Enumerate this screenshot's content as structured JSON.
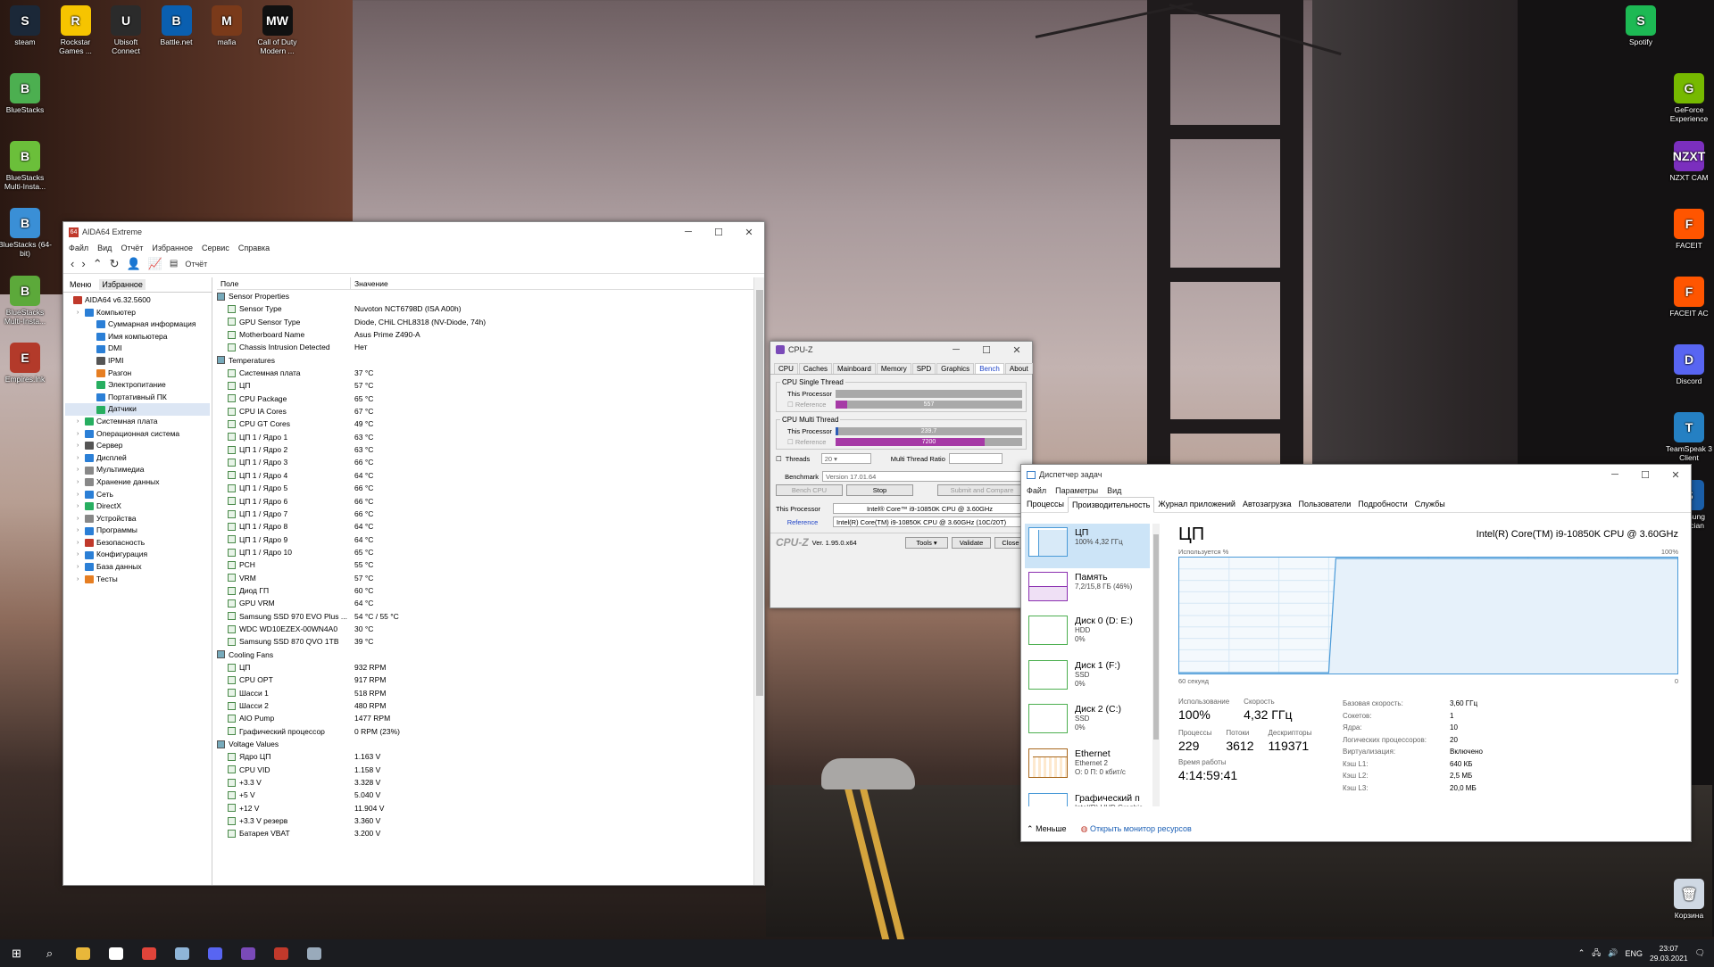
{
  "desktop": {
    "icons_left": [
      {
        "label": "steam",
        "color": "#1b2838",
        "glyph": "S"
      },
      {
        "label": "Rockstar Games ...",
        "color": "#f6c400",
        "glyph": "R"
      },
      {
        "label": "Ubisoft Connect",
        "color": "#2b2b2b",
        "glyph": "U"
      },
      {
        "label": "Battle.net",
        "color": "#0a5fb0",
        "glyph": "B"
      },
      {
        "label": "mafia",
        "color": "#7a3a1a",
        "glyph": "M"
      },
      {
        "label": "Call of Duty Modern ...",
        "color": "#111111",
        "glyph": "MW"
      }
    ],
    "icons_col": [
      {
        "label": "BlueStacks",
        "color": "#4caf50",
        "glyph": "B"
      },
      {
        "label": "BlueStacks Multi-Insta...",
        "color": "#6bbf3a",
        "glyph": "B"
      },
      {
        "label": "BlueStacks (64-bit)",
        "color": "#3a8fd6",
        "glyph": "B"
      },
      {
        "label": "BlueStacks Multi-Insta...",
        "color": "#5ca93a",
        "glyph": "B"
      },
      {
        "label": "Empires.lnk",
        "color": "#b33a2a",
        "glyph": "E"
      }
    ],
    "icons_right": [
      {
        "label": "Spotify",
        "color": "#1db954",
        "glyph": "S"
      },
      {
        "label": "GeForce Experience",
        "color": "#76b900",
        "glyph": "G"
      },
      {
        "label": "NZXT CAM",
        "color": "#7b2fbe",
        "glyph": "NZXT"
      },
      {
        "label": "FACEIT",
        "color": "#ff5500",
        "glyph": "F"
      },
      {
        "label": "FACEIT AC",
        "color": "#ff5500",
        "glyph": "F"
      },
      {
        "label": "Discord",
        "color": "#5865f2",
        "glyph": "D"
      },
      {
        "label": "TeamSpeak 3 Client",
        "color": "#2580c3",
        "glyph": "T"
      },
      {
        "label": "Samsung Magician",
        "color": "#1a5ea8",
        "glyph": "S"
      },
      {
        "label": "Корзина",
        "color": "#cfd8e3",
        "glyph": "🗑"
      }
    ]
  },
  "aida": {
    "title": "AIDA64 Extreme",
    "menu": [
      "Файл",
      "Вид",
      "Отчёт",
      "Избранное",
      "Сервис",
      "Справка"
    ],
    "report_label": "Отчёт",
    "tabs": [
      "Меню",
      "Избранное"
    ],
    "tree": [
      {
        "label": "AIDA64 v6.32.5600",
        "indent": 0,
        "color": "#c0392b"
      },
      {
        "label": "Компьютер",
        "indent": 1,
        "color": "#2b7fd6"
      },
      {
        "label": "Суммарная информация",
        "indent": 2,
        "color": "#2b7fd6"
      },
      {
        "label": "Имя компьютера",
        "indent": 2,
        "color": "#2b7fd6"
      },
      {
        "label": "DMI",
        "indent": 2,
        "color": "#2b7fd6"
      },
      {
        "label": "IPMI",
        "indent": 2,
        "color": "#555"
      },
      {
        "label": "Разгон",
        "indent": 2,
        "color": "#e67e22"
      },
      {
        "label": "Электропитание",
        "indent": 2,
        "color": "#27ae60"
      },
      {
        "label": "Портативный ПК",
        "indent": 2,
        "color": "#2b7fd6"
      },
      {
        "label": "Датчики",
        "indent": 2,
        "color": "#27ae60",
        "selected": true
      },
      {
        "label": "Системная плата",
        "indent": 1,
        "color": "#27ae60"
      },
      {
        "label": "Операционная система",
        "indent": 1,
        "color": "#2b7fd6"
      },
      {
        "label": "Сервер",
        "indent": 1,
        "color": "#555"
      },
      {
        "label": "Дисплей",
        "indent": 1,
        "color": "#2b7fd6"
      },
      {
        "label": "Мультимедиа",
        "indent": 1,
        "color": "#888"
      },
      {
        "label": "Хранение данных",
        "indent": 1,
        "color": "#888"
      },
      {
        "label": "Сеть",
        "indent": 1,
        "color": "#2b7fd6"
      },
      {
        "label": "DirectX",
        "indent": 1,
        "color": "#27ae60"
      },
      {
        "label": "Устройства",
        "indent": 1,
        "color": "#888"
      },
      {
        "label": "Программы",
        "indent": 1,
        "color": "#2b7fd6"
      },
      {
        "label": "Безопасность",
        "indent": 1,
        "color": "#c0392b"
      },
      {
        "label": "Конфигурация",
        "indent": 1,
        "color": "#2b7fd6"
      },
      {
        "label": "База данных",
        "indent": 1,
        "color": "#2b7fd6"
      },
      {
        "label": "Тесты",
        "indent": 1,
        "color": "#e67e22"
      }
    ],
    "col_field": "Поле",
    "col_value": "Значение",
    "rows": [
      {
        "f": "Sensor Properties",
        "v": "",
        "s": true
      },
      {
        "f": "Sensor Type",
        "v": "Nuvoton NCT6798D  (ISA A00h)"
      },
      {
        "f": "GPU Sensor Type",
        "v": "Diode, CHiL CHL8318  (NV-Diode, 74h)"
      },
      {
        "f": "Motherboard Name",
        "v": "Asus Prime Z490-A"
      },
      {
        "f": "Chassis Intrusion Detected",
        "v": "Нет"
      },
      {
        "f": "",
        "v": ""
      },
      {
        "f": "Temperatures",
        "v": "",
        "s": true
      },
      {
        "f": "Системная плата",
        "v": "37 °C"
      },
      {
        "f": "ЦП",
        "v": "57 °C"
      },
      {
        "f": "CPU Package",
        "v": "65 °C"
      },
      {
        "f": "CPU IA Cores",
        "v": "67 °C"
      },
      {
        "f": "CPU GT Cores",
        "v": "49 °C"
      },
      {
        "f": "ЦП 1 / Ядро 1",
        "v": "63 °C"
      },
      {
        "f": "ЦП 1 / Ядро 2",
        "v": "63 °C"
      },
      {
        "f": "ЦП 1 / Ядро 3",
        "v": "66 °C"
      },
      {
        "f": "ЦП 1 / Ядро 4",
        "v": "64 °C"
      },
      {
        "f": "ЦП 1 / Ядро 5",
        "v": "66 °C"
      },
      {
        "f": "ЦП 1 / Ядро 6",
        "v": "66 °C"
      },
      {
        "f": "ЦП 1 / Ядро 7",
        "v": "66 °C"
      },
      {
        "f": "ЦП 1 / Ядро 8",
        "v": "64 °C"
      },
      {
        "f": "ЦП 1 / Ядро 9",
        "v": "64 °C"
      },
      {
        "f": "ЦП 1 / Ядро 10",
        "v": "65 °C"
      },
      {
        "f": "PCH",
        "v": "55 °C"
      },
      {
        "f": "VRM",
        "v": "57 °C"
      },
      {
        "f": "Диод ГП",
        "v": "60 °C"
      },
      {
        "f": "GPU VRM",
        "v": "64 °C"
      },
      {
        "f": "Samsung SSD 970 EVO Plus ...",
        "v": "54 °C / 55 °C"
      },
      {
        "f": "WDC WD10EZEX-00WN4A0",
        "v": "30 °C"
      },
      {
        "f": "Samsung SSD 870 QVO 1TB",
        "v": "39 °C"
      },
      {
        "f": "",
        "v": ""
      },
      {
        "f": "Cooling Fans",
        "v": "",
        "s": true
      },
      {
        "f": "ЦП",
        "v": "932 RPM"
      },
      {
        "f": "CPU OPT",
        "v": "917 RPM"
      },
      {
        "f": "Шасси 1",
        "v": "518 RPM"
      },
      {
        "f": "Шасси 2",
        "v": "480 RPM"
      },
      {
        "f": "AIO Pump",
        "v": "1477 RPM"
      },
      {
        "f": "Графический процессор",
        "v": "0 RPM  (23%)"
      },
      {
        "f": "",
        "v": ""
      },
      {
        "f": "Voltage Values",
        "v": "",
        "s": true
      },
      {
        "f": "Ядро ЦП",
        "v": "1.163 V"
      },
      {
        "f": "CPU VID",
        "v": "1.158 V"
      },
      {
        "f": "+3.3 V",
        "v": "3.328 V"
      },
      {
        "f": "+5 V",
        "v": "5.040 V"
      },
      {
        "f": "+12 V",
        "v": "11.904 V"
      },
      {
        "f": "+3.3 V резерв",
        "v": "3.360 V"
      },
      {
        "f": "Батарея VBAT",
        "v": "3.200 V"
      }
    ]
  },
  "cpuz": {
    "title": "CPU-Z",
    "tabs": [
      "CPU",
      "Caches",
      "Mainboard",
      "Memory",
      "SPD",
      "Graphics",
      "Bench",
      "About"
    ],
    "active_tab": "Bench",
    "single_legend": "CPU Single Thread",
    "multi_legend": "CPU Multi Thread",
    "this_processor": "This Processor",
    "reference": "Reference",
    "single_this_value": "",
    "single_ref_value": "557",
    "multi_this_value": "239.7",
    "multi_ref_value": "7200",
    "single_this_fraction": 0.0,
    "single_ref_fraction": 0.06,
    "multi_this_fraction": 0.015,
    "multi_ref_fraction": 0.8,
    "threads_label": "Threads",
    "threads_value": "20",
    "ratio_label": "Multi Thread Ratio",
    "benchmark_label": "Benchmark",
    "benchmark_value": "Version 17.01.64",
    "bench_cpu": "Bench CPU",
    "stop": "Stop",
    "submit": "Submit and Compare",
    "proc_label": "This Processor",
    "proc_value": "Intel® Core™ i9-10850K CPU @ 3.60GHz",
    "ref_label": "Reference",
    "ref_value": "Intel(R) Core(TM) i9-10850K CPU @ 3.60GHz (10C/20T)",
    "logo": "CPU-Z",
    "version": "Ver. 1.95.0.x64",
    "tools": "Tools",
    "validate": "Validate",
    "close": "Close",
    "colors": {
      "ref": "#a63aa6",
      "this": "#2b5bb5"
    }
  },
  "taskmgr": {
    "title": "Диспетчер задач",
    "menu": [
      "Файл",
      "Параметры",
      "Вид"
    ],
    "tabs": [
      "Процессы",
      "Производительность",
      "Журнал приложений",
      "Автозагрузка",
      "Пользователи",
      "Подробности",
      "Службы"
    ],
    "active_tab": "Производительность",
    "side": [
      {
        "name": "ЦП",
        "l1": "100% 4,32 ГГц",
        "l2": "",
        "color": "#4a9ad8"
      },
      {
        "name": "Память",
        "l1": "7,2/15,8 ГБ (46%)",
        "l2": "",
        "color": "#8b2fb0"
      },
      {
        "name": "Диск 0 (D: E:)",
        "l1": "HDD",
        "l2": "0%",
        "color": "#4caf50"
      },
      {
        "name": "Диск 1 (F:)",
        "l1": "SSD",
        "l2": "0%",
        "color": "#4caf50"
      },
      {
        "name": "Диск 2 (C:)",
        "l1": "SSD",
        "l2": "0%",
        "color": "#4caf50"
      },
      {
        "name": "Ethernet",
        "l1": "Ethernet 2",
        "l2": "О: 0 П: 0 кбит/с",
        "color": "#a8671b"
      },
      {
        "name": "Графический п",
        "l1": "Intel(R) UHD Graphic",
        "l2": "",
        "color": "#4a9ad8"
      }
    ],
    "heading": "ЦП",
    "model": "Intel(R) Core(TM) i9-10850K CPU @ 3.60GHz",
    "graph_label": "Используется %",
    "graph_max": "100%",
    "graph_time": "60 секунд",
    "graph_min": "0",
    "usage_label": "Использование",
    "usage_value": "100%",
    "speed_label": "Скорость",
    "speed_value": "4,32 ГГц",
    "proc_label": "Процессы",
    "proc_value": "229",
    "threads_label": "Потоки",
    "threads_value": "3612",
    "handles_label": "Дескрипторы",
    "handles_value": "119371",
    "uptime_label": "Время работы",
    "uptime_value": "4:14:59:41",
    "details": [
      {
        "k": "Базовая скорость:",
        "v": "3,60 ГГц"
      },
      {
        "k": "Сокетов:",
        "v": "1"
      },
      {
        "k": "Ядра:",
        "v": "10"
      },
      {
        "k": "Логических процессоров:",
        "v": "20"
      },
      {
        "k": "Виртуализация:",
        "v": "Включено"
      },
      {
        "k": "Кэш L1:",
        "v": "640 КБ"
      },
      {
        "k": "Кэш L2:",
        "v": "2,5 МБ"
      },
      {
        "k": "Кэш L3:",
        "v": "20,0 МБ"
      }
    ],
    "less": "Меньше",
    "monitor": "Открыть монитор ресурсов"
  },
  "taskbar": {
    "lang": "ENG",
    "time": "23:07",
    "date": "29.03.2021",
    "apps": [
      {
        "name": "explorer",
        "color": "#e8b73a"
      },
      {
        "name": "nvidia",
        "color": "#ffffff"
      },
      {
        "name": "chrome",
        "color": "#e0443a"
      },
      {
        "name": "steam",
        "color": "#8fb5d8"
      },
      {
        "name": "discord",
        "color": "#5865f2"
      },
      {
        "name": "cpuz",
        "color": "#7a4ab8"
      },
      {
        "name": "aida64",
        "color": "#c0392b"
      },
      {
        "name": "taskmgr",
        "color": "#9ab"
      }
    ]
  }
}
